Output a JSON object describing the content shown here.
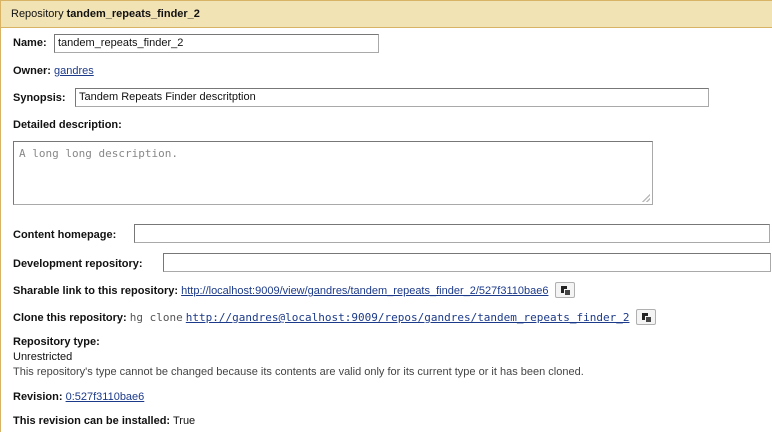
{
  "header": {
    "prefix": "Repository",
    "repo_name": "tandem_repeats_finder_2"
  },
  "name": {
    "label": "Name:",
    "value": "tandem_repeats_finder_2"
  },
  "owner": {
    "label": "Owner:",
    "value": "gandres"
  },
  "synopsis": {
    "label": "Synopsis:",
    "value": "Tandem Repeats Finder descritption"
  },
  "description": {
    "label": "Detailed description:",
    "value": "A long long description."
  },
  "content_homepage": {
    "label": "Content homepage:",
    "value": ""
  },
  "dev_repo": {
    "label": "Development repository:",
    "value": ""
  },
  "sharable": {
    "label": "Sharable link to this repository:",
    "url": "http://localhost:9009/view/gandres/tandem_repeats_finder_2/527f3110bae6"
  },
  "clone": {
    "label": "Clone this repository:",
    "command": "hg clone",
    "url": "http://gandres@localhost:9009/repos/gandres/tandem_repeats_finder_2"
  },
  "repo_type": {
    "label": "Repository type:",
    "value": "Unrestricted",
    "note": "This repository's type cannot be changed because its contents are valid only for its current type or it has been cloned."
  },
  "revision": {
    "label": "Revision:",
    "value": "0:527f3110bae6"
  },
  "installable": {
    "label": "This revision can be installed:",
    "value": "True"
  },
  "icons": {
    "copy": "clipboard-copy-icon"
  },
  "colors": {
    "header_bg": "#f2e3b4",
    "header_border": "#d8b365",
    "link": "#1c3a8a"
  }
}
